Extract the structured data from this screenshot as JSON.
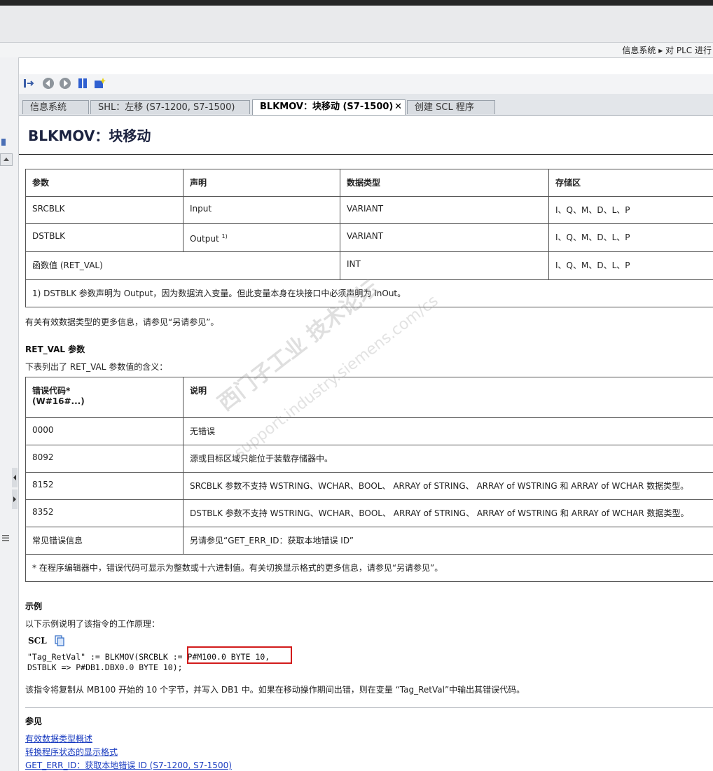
{
  "breadcrumb": "信息系统 ▸ 对 PLC 进行",
  "toolbar": {
    "icons": [
      "sync-icon",
      "back-icon",
      "forward-icon",
      "bookmark-icon",
      "new-window-icon"
    ]
  },
  "tabs": [
    {
      "label": "信息系统",
      "active": false
    },
    {
      "label": "SHL：左移 (S7-1200, S7-1500)",
      "active": false
    },
    {
      "label": "BLKMOV：块移动 (S7-1500)",
      "active": true,
      "close": "✕"
    },
    {
      "label": "创建 SCL 程序",
      "active": false
    }
  ],
  "page_title": "BLKMOV：块移动",
  "param_table": {
    "headers": [
      "参数",
      "声明",
      "数据类型",
      "存储区"
    ],
    "rows": [
      {
        "param": "SRCBLK",
        "decl": "Input",
        "type": "VARIANT",
        "area": "I、Q、M、D、L、P"
      },
      {
        "param": "DSTBLK",
        "decl": "Output",
        "sup": "1)",
        "type": "VARIANT",
        "area": "I、Q、M、D、L、P"
      },
      {
        "param": "函数值 (RET_VAL)",
        "type": "INT",
        "area": "I、Q、M、D、L、P"
      }
    ],
    "footnote": "1) DSTBLK 参数声明为 Output，因为数据流入变量。但此变量本身在块接口中必须声明为 InOut。"
  },
  "more_info": "有关有效数据类型的更多信息，请参见“另请参见”。",
  "retval_heading": "RET_VAL 参数",
  "retval_intro": "下表列出了 RET_VAL 参数值的含义：",
  "err_table": {
    "headers": [
      "错误代码*",
      "(W#16#...)",
      "说明"
    ],
    "rows": [
      {
        "code": "0000",
        "desc": "无错误"
      },
      {
        "code": "8092",
        "desc": "源或目标区域只能位于装载存储器中。"
      },
      {
        "code": "8152",
        "desc": "SRCBLK 参数不支持 WSTRING、WCHAR、BOOL、 ARRAY of STRING、 ARRAY of WSTRING 和 ARRAY of WCHAR 数据类型。"
      },
      {
        "code": "8352",
        "desc": "DSTBLK 参数不支持 WSTRING、WCHAR、BOOL、 ARRAY of STRING、 ARRAY of WSTRING 和 ARRAY of WCHAR 数据类型。"
      },
      {
        "code": "常见错误信息",
        "desc": "另请参见“GET_ERR_ID：获取本地错误 ID”"
      }
    ],
    "footnote": "* 在程序编辑器中，错误代码可显示为整数或十六进制值。有关切换显示格式的更多信息，请参见“另请参见”。"
  },
  "example_heading": "示例",
  "example_intro": "以下示例说明了该指令的工作原理：",
  "scl_label": "SCL",
  "code_line1": "\"Tag_RetVal\" := BLKMOV(SRCBLK := P#M100.0 BYTE 10,",
  "code_line2": "DSTBLK => P#DB1.DBX0.0 BYTE 10);",
  "example_desc": "该指令将复制从 MB100 开始的 10 个字节，并写入 DB1 中。如果在移动操作期间出错，则在变量 “Tag_RetVal”中输出其错误代码。",
  "see_also_heading": "参见",
  "see_also_links": [
    "有效数据类型概述",
    "转换程序状态的显示格式",
    "GET_ERR_ID：获取本地错误 ID (S7-1200, S7-1500)"
  ],
  "watermark_line1": "西门子工业 技术论坛",
  "watermark_line2": "support.industry.siemens.com/cs"
}
